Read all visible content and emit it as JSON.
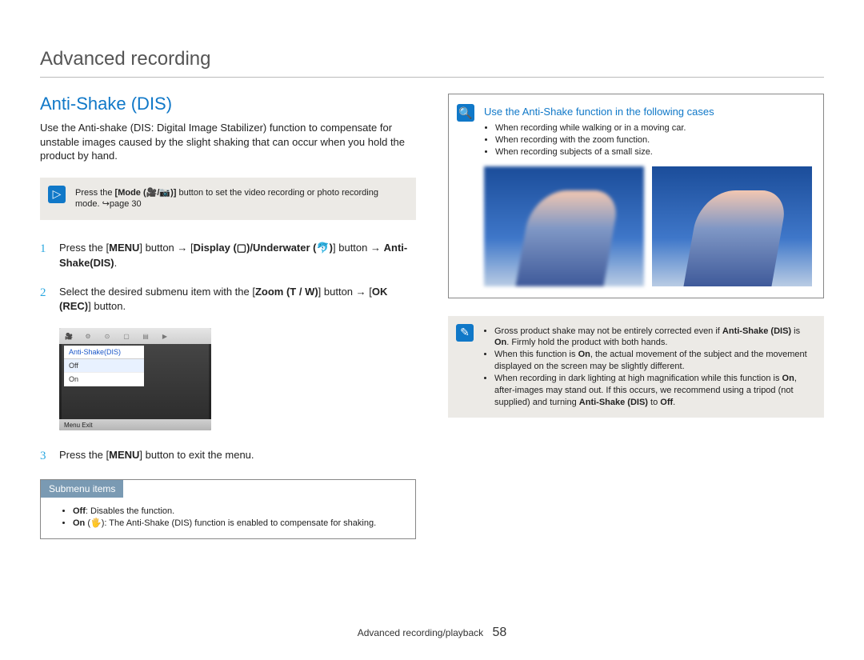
{
  "page": {
    "heading": "Advanced recording",
    "section_title": "Anti-Shake (DIS)",
    "intro": "Use the Anti-shake (DIS: Digital Image Stabilizer) function to compensate for unstable images caused by the slight shaking that can occur when you hold the product by hand.",
    "footer_section": "Advanced recording/playback",
    "footer_pagenum": "58"
  },
  "mode_note": {
    "text_pre": "Press the ",
    "bold1": "[Mode (🎥/📷)]",
    "text_post": " button to set the video recording or photo recording mode. ↪page 30"
  },
  "steps": [
    {
      "num": "1",
      "text_parts": {
        "p1": "Press the [",
        "b1": "MENU",
        "p2": "] button → [",
        "b2": "Display (▢)/Underwater (🐬)",
        "p3": "] button → ",
        "b3": "Anti-Shake(DIS)",
        "p4": "."
      }
    },
    {
      "num": "2",
      "text_parts": {
        "p1": "Select the desired submenu item with the [",
        "b1": "Zoom (T / W)",
        "p2": "] button → [",
        "b2": "OK (REC)",
        "p3": "] button."
      }
    },
    {
      "num": "3",
      "text_parts": {
        "p1": "Press the [",
        "b1": "MENU",
        "p2": "] button to exit the menu."
      }
    }
  ],
  "screenshot": {
    "menu_title": "Anti-Shake(DIS)",
    "items": [
      "Off",
      "On"
    ],
    "selected_index": 0,
    "bottom_label": "Menu Exit"
  },
  "submenu": {
    "tab_label": "Submenu items",
    "items": [
      {
        "bold": "Off",
        "text": ": Disables the function."
      },
      {
        "bold": "On",
        "icon": "(🖐️)",
        "text": ": The Anti-Shake (DIS) function is enabled to compensate for shaking."
      }
    ]
  },
  "tip": {
    "title": "Use the Anti-Shake function in the following cases",
    "bullets": [
      "When recording while walking or in a moving car.",
      "When recording with the zoom function.",
      "When recording subjects of a small size."
    ]
  },
  "warn": {
    "bullets_html": [
      "Gross product shake may not be entirely corrected even if <b>Anti-Shake (DIS)</b> is <b>On</b>. Firmly hold the product with both hands.",
      "When this function is <b>On</b>, the actual movement of the subject and the movement displayed on the screen may be slightly different.",
      "When recording in dark lighting at high magnification while this function is <b>On</b>, after-images may stand out. If this occurs, we recommend using a tripod (not supplied) and turning <b>Anti-Shake (DIS)</b> to <b>Off</b>."
    ]
  }
}
